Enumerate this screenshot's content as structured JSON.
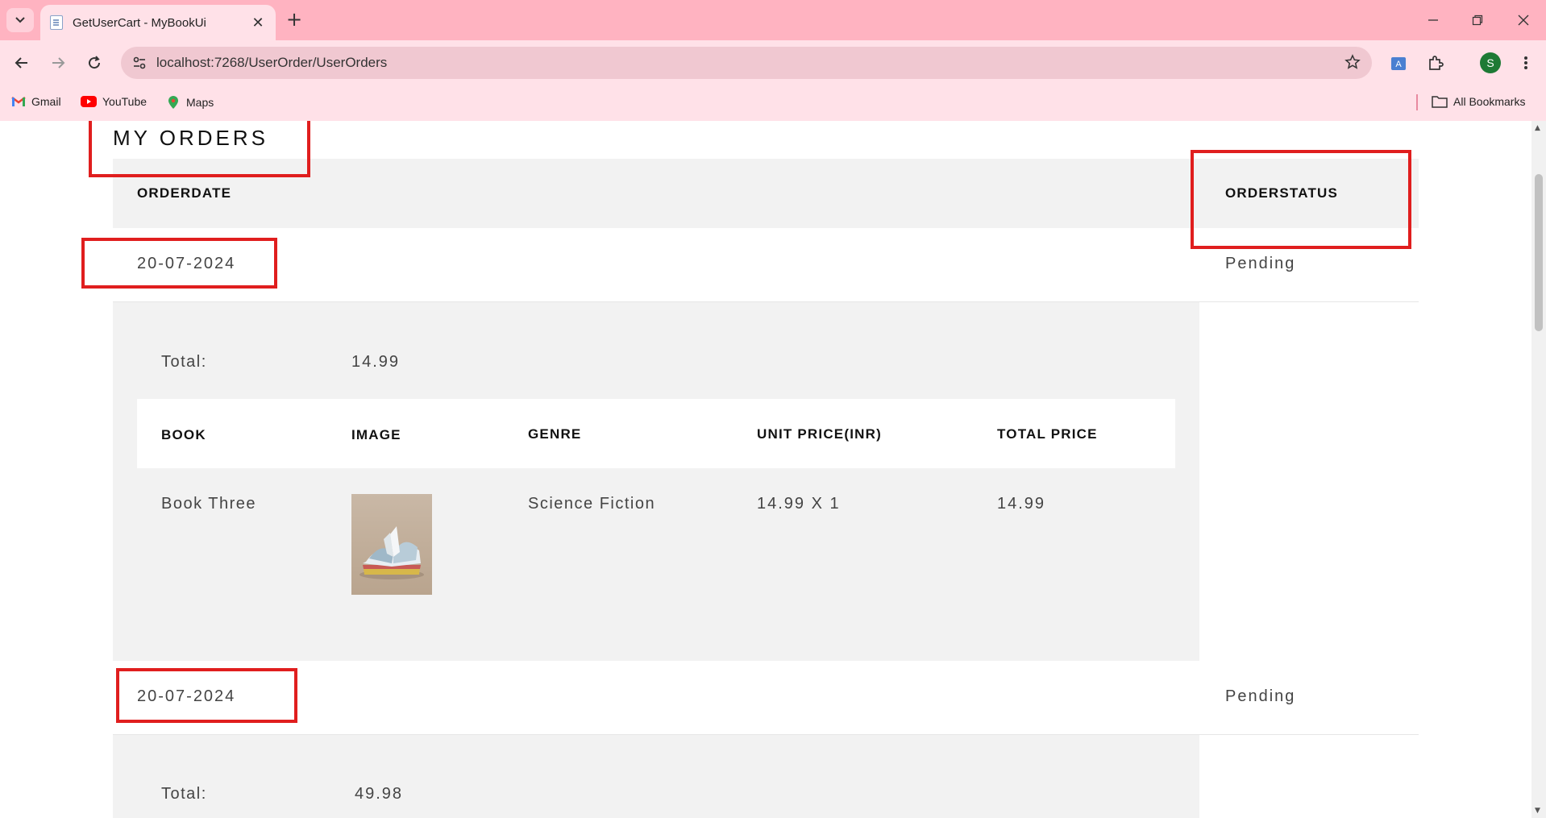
{
  "browser": {
    "tab_title": "GetUserCart - MyBookUi",
    "url": "localhost:7268/UserOrder/UserOrders",
    "profile_initial": "S",
    "bookmarks": [
      {
        "label": "Gmail",
        "icon": "gmail-icon"
      },
      {
        "label": "YouTube",
        "icon": "youtube-icon"
      },
      {
        "label": "Maps",
        "icon": "maps-icon"
      }
    ],
    "all_bookmarks_label": "All Bookmarks",
    "colors": {
      "tabbar": "#ffb3c1",
      "toolbar": "#ffe1e8"
    }
  },
  "page": {
    "title": "MY ORDERS",
    "headers": {
      "order_date": "ORDERDATE",
      "order_status": "ORDERSTATUS"
    },
    "orders": [
      {
        "date": "20-07-2024",
        "status": "Pending",
        "total_label": "Total:",
        "total": "14.99",
        "columns": [
          "BOOK",
          "IMAGE",
          "GENRE",
          "UNIT PRICE(INR)",
          "TOTAL PRICE"
        ],
        "items": [
          {
            "book": "Book Three",
            "image": "book-cover-image",
            "genre": "Science Fiction",
            "unit_price": "14.99 X 1",
            "total_price": "14.99"
          }
        ]
      },
      {
        "date": "20-07-2024",
        "status": "Pending",
        "total_label": "Total:",
        "total": "49.98"
      }
    ],
    "highlight_color": "#e01e1e"
  }
}
